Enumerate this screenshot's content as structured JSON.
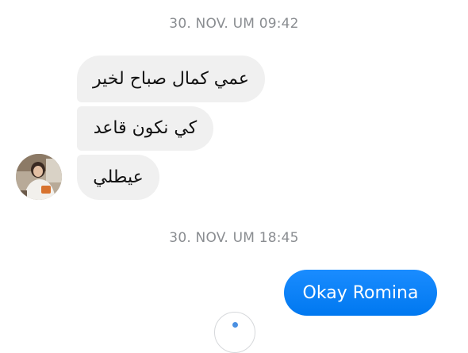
{
  "conversation": {
    "timestamps": [
      "30. NOV. UM 09:42",
      "30. NOV. UM 18:45"
    ],
    "incoming_messages": [
      "عمي كمال صباح لخير",
      "كي نكون قاعد",
      "عيطلي"
    ],
    "outgoing_messages": [
      "Okay Romina"
    ]
  },
  "colors": {
    "incoming_bubble": "#f0f0f0",
    "outgoing_bubble": "#0a84ff",
    "timestamp_text": "#8a8d91"
  }
}
